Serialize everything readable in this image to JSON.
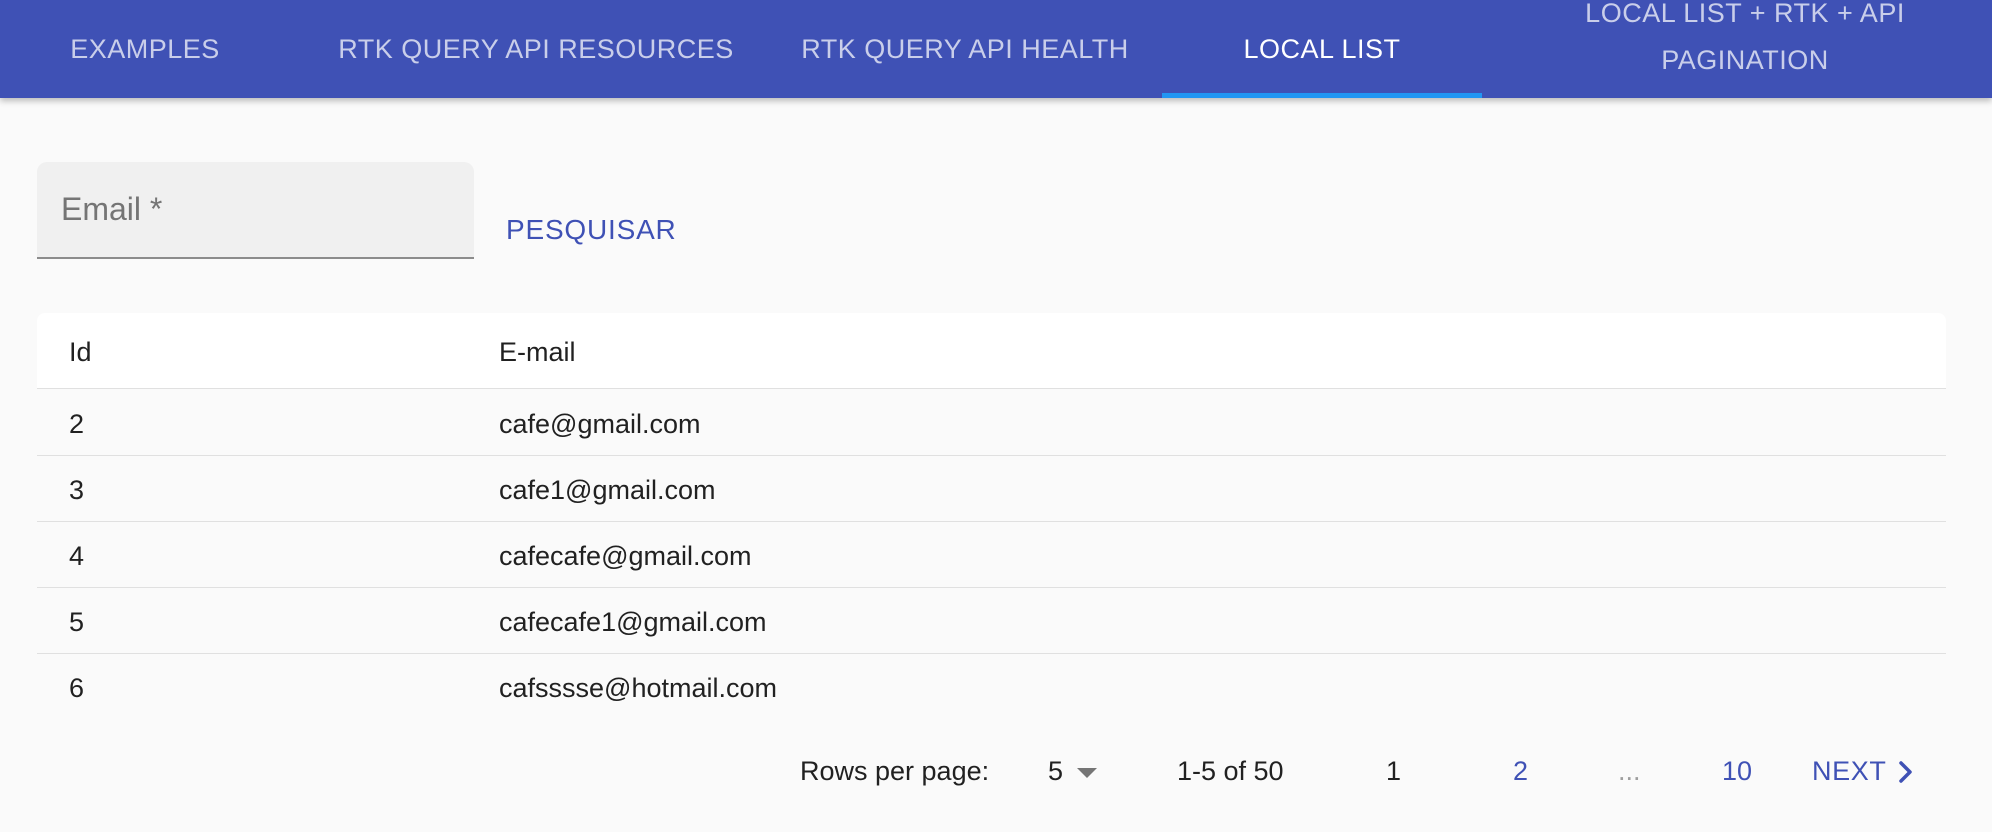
{
  "tabs": [
    {
      "label": "EXAMPLES",
      "active": false
    },
    {
      "label": "RTK QUERY API RESOURCES",
      "active": false
    },
    {
      "label": "RTK QUERY API HEALTH",
      "active": false
    },
    {
      "label": "LOCAL LIST",
      "active": true
    },
    {
      "label_line1": "LOCAL LIST + RTK + API",
      "label_line2": "PAGINATION",
      "active": false
    }
  ],
  "search": {
    "email_placeholder": "Email *",
    "email_value": "",
    "button_label": "PESQUISAR"
  },
  "table": {
    "columns": [
      "Id",
      "E-mail"
    ],
    "rows": [
      {
        "id": "2",
        "email": "cafe@gmail.com"
      },
      {
        "id": "3",
        "email": "cafe1@gmail.com"
      },
      {
        "id": "4",
        "email": "cafecafe@gmail.com"
      },
      {
        "id": "5",
        "email": "cafecafe1@gmail.com"
      },
      {
        "id": "6",
        "email": "cafsssse@hotmail.com"
      }
    ]
  },
  "pagination": {
    "rows_per_page_label": "Rows per page:",
    "rows_per_page_value": "5",
    "range_text": "1-5 of 50",
    "pages": [
      "1",
      "2",
      "...",
      "10"
    ],
    "current_page": "1",
    "next_label": "NEXT"
  },
  "colors": {
    "app_bar": "#3f51b5",
    "tab_indicator": "#2196f3",
    "primary_text_button": "#3f51b5",
    "background": "#fafafa"
  },
  "icons": {
    "rows_select": "caret-down-icon",
    "next": "chevron-right-icon"
  }
}
